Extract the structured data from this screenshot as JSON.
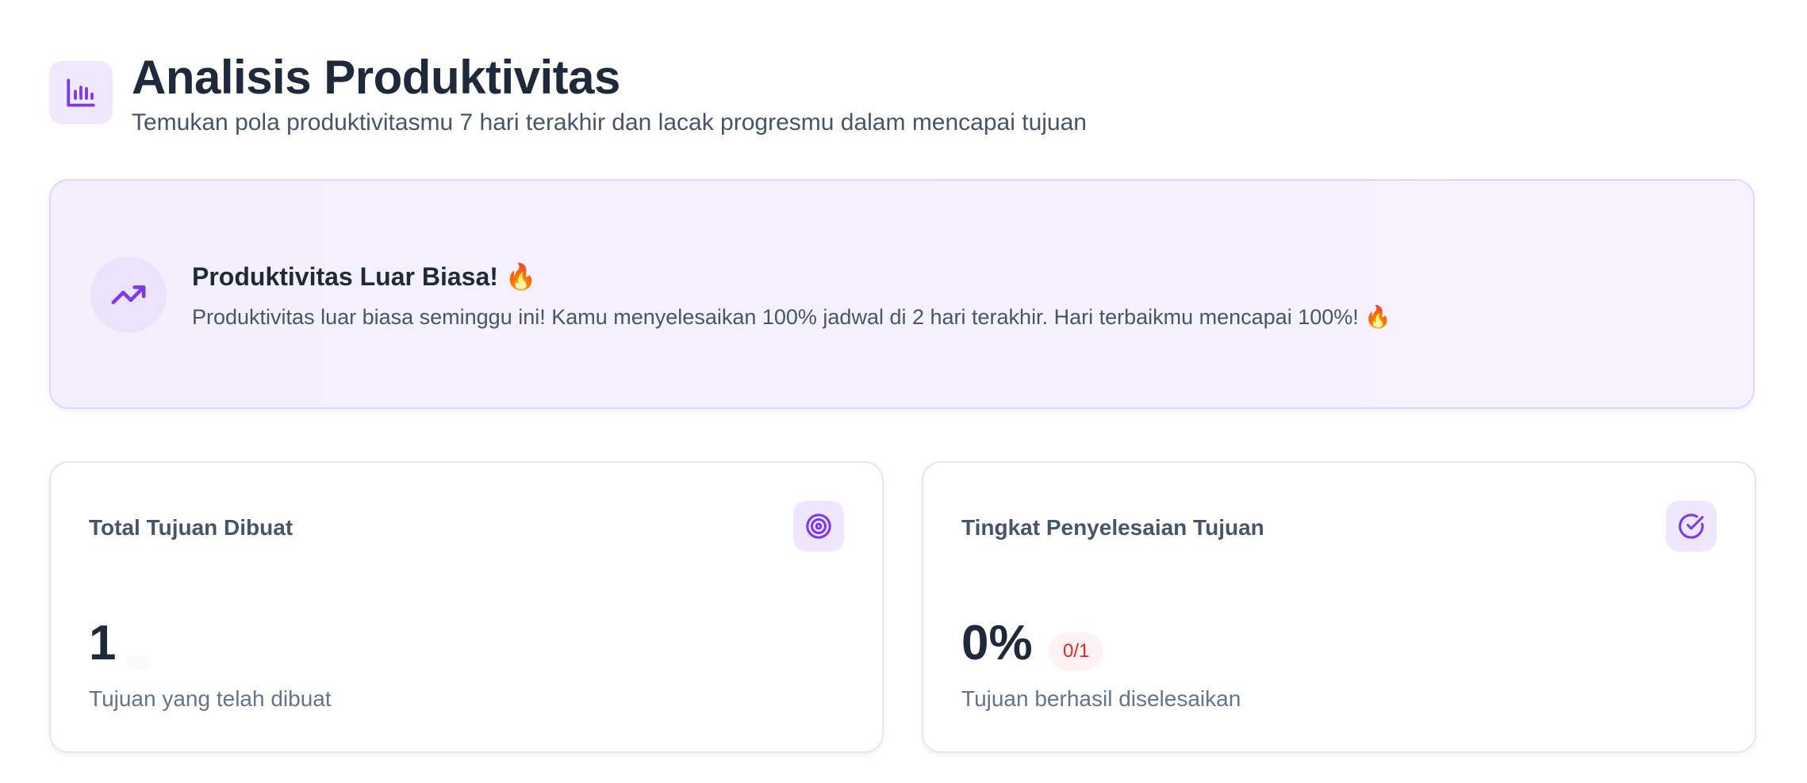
{
  "header": {
    "icon": "bar-chart-icon",
    "title": "Analisis Produktivitas",
    "subtitle": "Temukan pola produktivitasmu 7 hari terakhir dan lacak progresmu dalam mencapai tujuan"
  },
  "insight": {
    "icon": "trending-up-icon",
    "title": "Produktivitas Luar Biasa!",
    "title_emoji": "🔥",
    "message": "Produktivitas luar biasa seminggu ini! Kamu menyelesaikan 100% jadwal di 2 hari terakhir. Hari terbaikmu mencapai 100%!",
    "message_emoji": "🔥"
  },
  "cards": [
    {
      "label": "Total Tujuan Dibuat",
      "icon": "target-icon",
      "value": "1",
      "caption": "Tujuan yang telah dibuat"
    },
    {
      "label": "Tingkat Penyelesaian Tujuan",
      "icon": "check-circle-icon",
      "value": "0%",
      "badge": "0/1",
      "caption": "Tujuan berhasil diselesaikan"
    }
  ],
  "colors": {
    "accent": "#7c3aed",
    "accent_light": "#f0e9fe",
    "danger": "#dc2626",
    "danger_light": "#fef2f2",
    "text_dark": "#1e293b",
    "text_muted": "#64748b"
  }
}
